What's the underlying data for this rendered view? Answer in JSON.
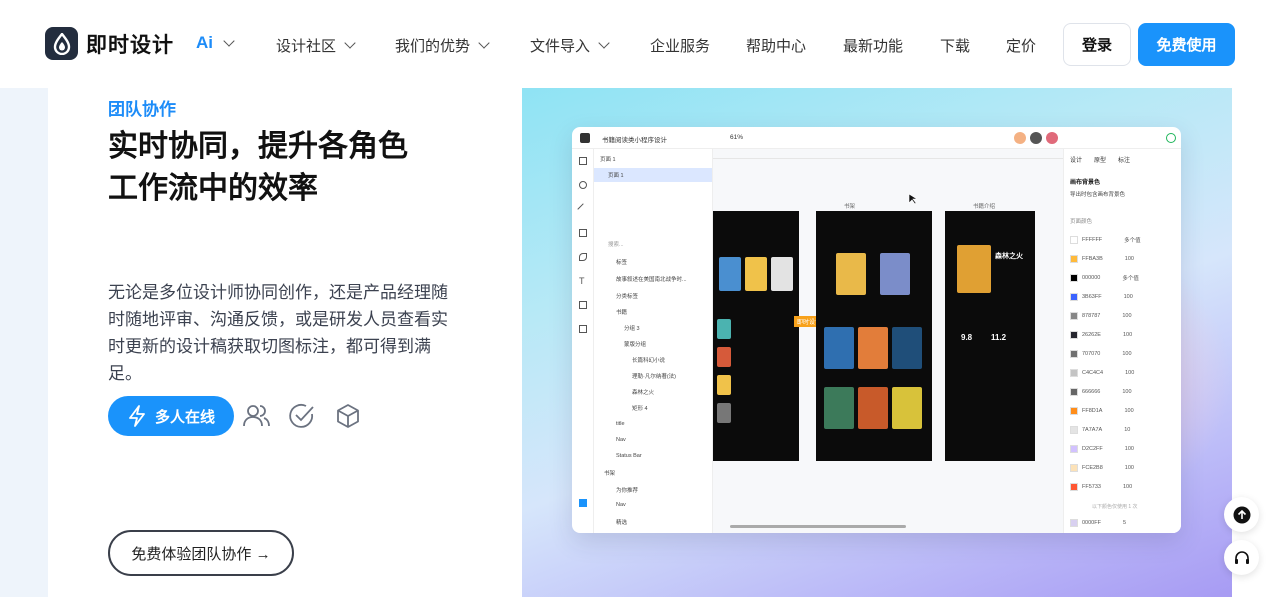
{
  "brand": {
    "name": "即时设计",
    "ai_label": "Ai"
  },
  "nav": {
    "items": [
      {
        "label": "设计社区",
        "dropdown": true
      },
      {
        "label": "我们的优势",
        "dropdown": true
      },
      {
        "label": "文件导入",
        "dropdown": true
      },
      {
        "label": "企业服务",
        "dropdown": false
      },
      {
        "label": "帮助中心",
        "dropdown": false
      },
      {
        "label": "最新功能",
        "dropdown": false
      },
      {
        "label": "下载",
        "dropdown": false
      },
      {
        "label": "定价",
        "dropdown": false
      }
    ],
    "login": "登录",
    "free_use": "免费使用"
  },
  "hero": {
    "eyebrow": "团队协作",
    "headline_line1": "实时协同，提升各角色",
    "headline_line2": "工作流中的效率",
    "description": "无论是多位设计师协同创作，还是产品经理随时随地评审、沟通反馈，或是研发人员查看实时更新的设计稿获取切图标注，都可得到满足。",
    "active_feature": "多人在线",
    "feature_icons": [
      "users-icon",
      "check-circle-icon",
      "cube-icon"
    ],
    "cta": "免费体验团队协作 →"
  },
  "mockup": {
    "file_title": "书籍阅读类小程序设计",
    "zoom": "61%",
    "page_label": "页面 1",
    "layers": [
      "页面 1",
      "搜索...",
      "标签",
      "故事叙述在美国南北战争时...",
      "分类标签",
      "书籍",
      "分组 3",
      "蒙版分组",
      "长篇科幻小说",
      "理勒·凡尔纳著(法)",
      "森林之火",
      "矩形 4",
      "title",
      "Nav",
      "Status Bar",
      "书架",
      "为你推荐",
      "Nav",
      "精选"
    ],
    "panel_tabs": [
      "设计",
      "原型",
      "标注"
    ],
    "panel_section": "画布背景色",
    "panel_checkbox": "导出时包含画布背景色",
    "panel_colors_title": "页面颜色",
    "colors": [
      {
        "hex": "FFFFFF",
        "value": "多个值"
      },
      {
        "hex": "FFBA3B",
        "value": "100"
      },
      {
        "hex": "000000",
        "value": "多个值"
      },
      {
        "hex": "3B63FF",
        "value": "100"
      },
      {
        "hex": "878787",
        "value": "100"
      },
      {
        "hex": "26262E",
        "value": "100"
      },
      {
        "hex": "707070",
        "value": "100"
      },
      {
        "hex": "C4C4C4",
        "value": "100"
      },
      {
        "hex": "666666",
        "value": "100"
      },
      {
        "hex": "FF8D1A",
        "value": "100"
      },
      {
        "hex": "7A7A7A",
        "value": "10"
      },
      {
        "hex": "D2C2FF",
        "value": "100"
      },
      {
        "hex": "FCE2B8",
        "value": "100"
      },
      {
        "hex": "FF5733",
        "value": "100"
      },
      {
        "hex": "0000FF",
        "value": "5"
      }
    ],
    "panel_footer": "以下颜色仅使用 1 次",
    "tag_label": "即时设计-Fio",
    "frame_labels": [
      "书架",
      "书籍介绍"
    ],
    "book_title": "森林之火",
    "rating": "9.8",
    "words": "11.2"
  },
  "floating": [
    "arrow-up-icon",
    "headset-icon"
  ],
  "colors": {
    "accent": "#1a93fb",
    "dark": "#232d3e"
  }
}
